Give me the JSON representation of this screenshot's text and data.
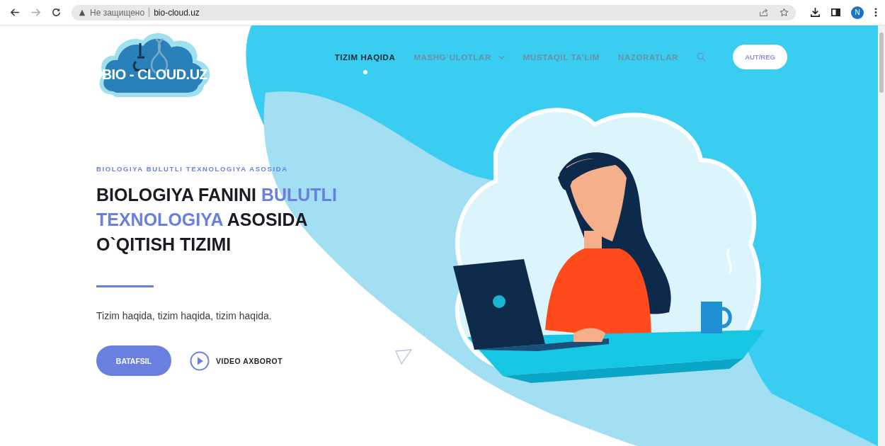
{
  "browser": {
    "security_label": "Не защищено",
    "url": "bio-cloud.uz",
    "profile_initial": "N"
  },
  "logo": {
    "text": "BIO - CLOUD.UZ"
  },
  "nav": [
    {
      "label": "TIZIM HAQIDA",
      "selected": true,
      "dropdown": false
    },
    {
      "label": "MASHG`ULOTLAR",
      "selected": false,
      "dropdown": true
    },
    {
      "label": "MUSTAQIL TA'LIM",
      "selected": false,
      "dropdown": false
    },
    {
      "label": "NAZORATLAR",
      "selected": false,
      "dropdown": false
    }
  ],
  "auth_button": "AUT/REG",
  "hero": {
    "tagline": "BIOLOGIYA BULUTLI TEXNOLOGIYA ASOSIDA",
    "heading": [
      {
        "text": "BIOLOGIYA FANINI ",
        "highlight": false
      },
      {
        "text": "BULUTLI TEXNOLOGIYA",
        "highlight": true
      },
      {
        "text": " ASOSIDA O`QITISH TIZIMI",
        "highlight": false
      }
    ],
    "description": "Tizim haqida, tizim haqida, tizim haqida.",
    "primary_button": "BATAFSIL",
    "video_link": "VIDEO AXBOROT"
  }
}
